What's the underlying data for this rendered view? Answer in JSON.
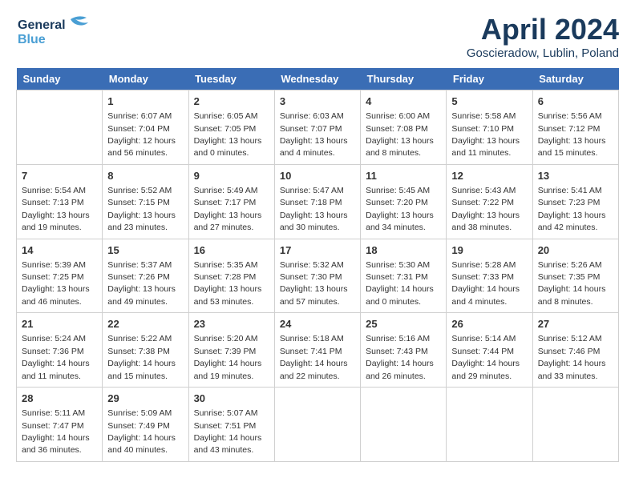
{
  "logo": {
    "line1": "General",
    "line2": "Blue"
  },
  "title": "April 2024",
  "location": "Goscieradow, Lublin, Poland",
  "weekdays": [
    "Sunday",
    "Monday",
    "Tuesday",
    "Wednesday",
    "Thursday",
    "Friday",
    "Saturday"
  ],
  "weeks": [
    [
      {
        "day": "",
        "info": ""
      },
      {
        "day": "1",
        "info": "Sunrise: 6:07 AM\nSunset: 7:04 PM\nDaylight: 12 hours\nand 56 minutes."
      },
      {
        "day": "2",
        "info": "Sunrise: 6:05 AM\nSunset: 7:05 PM\nDaylight: 13 hours\nand 0 minutes."
      },
      {
        "day": "3",
        "info": "Sunrise: 6:03 AM\nSunset: 7:07 PM\nDaylight: 13 hours\nand 4 minutes."
      },
      {
        "day": "4",
        "info": "Sunrise: 6:00 AM\nSunset: 7:08 PM\nDaylight: 13 hours\nand 8 minutes."
      },
      {
        "day": "5",
        "info": "Sunrise: 5:58 AM\nSunset: 7:10 PM\nDaylight: 13 hours\nand 11 minutes."
      },
      {
        "day": "6",
        "info": "Sunrise: 5:56 AM\nSunset: 7:12 PM\nDaylight: 13 hours\nand 15 minutes."
      }
    ],
    [
      {
        "day": "7",
        "info": "Sunrise: 5:54 AM\nSunset: 7:13 PM\nDaylight: 13 hours\nand 19 minutes."
      },
      {
        "day": "8",
        "info": "Sunrise: 5:52 AM\nSunset: 7:15 PM\nDaylight: 13 hours\nand 23 minutes."
      },
      {
        "day": "9",
        "info": "Sunrise: 5:49 AM\nSunset: 7:17 PM\nDaylight: 13 hours\nand 27 minutes."
      },
      {
        "day": "10",
        "info": "Sunrise: 5:47 AM\nSunset: 7:18 PM\nDaylight: 13 hours\nand 30 minutes."
      },
      {
        "day": "11",
        "info": "Sunrise: 5:45 AM\nSunset: 7:20 PM\nDaylight: 13 hours\nand 34 minutes."
      },
      {
        "day": "12",
        "info": "Sunrise: 5:43 AM\nSunset: 7:22 PM\nDaylight: 13 hours\nand 38 minutes."
      },
      {
        "day": "13",
        "info": "Sunrise: 5:41 AM\nSunset: 7:23 PM\nDaylight: 13 hours\nand 42 minutes."
      }
    ],
    [
      {
        "day": "14",
        "info": "Sunrise: 5:39 AM\nSunset: 7:25 PM\nDaylight: 13 hours\nand 46 minutes."
      },
      {
        "day": "15",
        "info": "Sunrise: 5:37 AM\nSunset: 7:26 PM\nDaylight: 13 hours\nand 49 minutes."
      },
      {
        "day": "16",
        "info": "Sunrise: 5:35 AM\nSunset: 7:28 PM\nDaylight: 13 hours\nand 53 minutes."
      },
      {
        "day": "17",
        "info": "Sunrise: 5:32 AM\nSunset: 7:30 PM\nDaylight: 13 hours\nand 57 minutes."
      },
      {
        "day": "18",
        "info": "Sunrise: 5:30 AM\nSunset: 7:31 PM\nDaylight: 14 hours\nand 0 minutes."
      },
      {
        "day": "19",
        "info": "Sunrise: 5:28 AM\nSunset: 7:33 PM\nDaylight: 14 hours\nand 4 minutes."
      },
      {
        "day": "20",
        "info": "Sunrise: 5:26 AM\nSunset: 7:35 PM\nDaylight: 14 hours\nand 8 minutes."
      }
    ],
    [
      {
        "day": "21",
        "info": "Sunrise: 5:24 AM\nSunset: 7:36 PM\nDaylight: 14 hours\nand 11 minutes."
      },
      {
        "day": "22",
        "info": "Sunrise: 5:22 AM\nSunset: 7:38 PM\nDaylight: 14 hours\nand 15 minutes."
      },
      {
        "day": "23",
        "info": "Sunrise: 5:20 AM\nSunset: 7:39 PM\nDaylight: 14 hours\nand 19 minutes."
      },
      {
        "day": "24",
        "info": "Sunrise: 5:18 AM\nSunset: 7:41 PM\nDaylight: 14 hours\nand 22 minutes."
      },
      {
        "day": "25",
        "info": "Sunrise: 5:16 AM\nSunset: 7:43 PM\nDaylight: 14 hours\nand 26 minutes."
      },
      {
        "day": "26",
        "info": "Sunrise: 5:14 AM\nSunset: 7:44 PM\nDaylight: 14 hours\nand 29 minutes."
      },
      {
        "day": "27",
        "info": "Sunrise: 5:12 AM\nSunset: 7:46 PM\nDaylight: 14 hours\nand 33 minutes."
      }
    ],
    [
      {
        "day": "28",
        "info": "Sunrise: 5:11 AM\nSunset: 7:47 PM\nDaylight: 14 hours\nand 36 minutes."
      },
      {
        "day": "29",
        "info": "Sunrise: 5:09 AM\nSunset: 7:49 PM\nDaylight: 14 hours\nand 40 minutes."
      },
      {
        "day": "30",
        "info": "Sunrise: 5:07 AM\nSunset: 7:51 PM\nDaylight: 14 hours\nand 43 minutes."
      },
      {
        "day": "",
        "info": ""
      },
      {
        "day": "",
        "info": ""
      },
      {
        "day": "",
        "info": ""
      },
      {
        "day": "",
        "info": ""
      }
    ]
  ]
}
